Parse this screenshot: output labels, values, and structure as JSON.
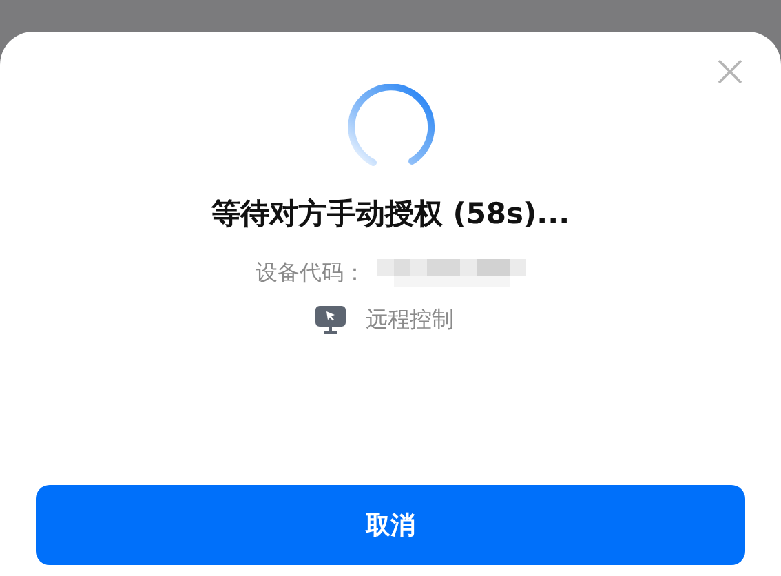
{
  "dialog": {
    "title": "等待对方手动授权 (58s)...",
    "device_code_label": "设备代码：",
    "mode_label": "远程控制",
    "cancel_button": "取消"
  }
}
